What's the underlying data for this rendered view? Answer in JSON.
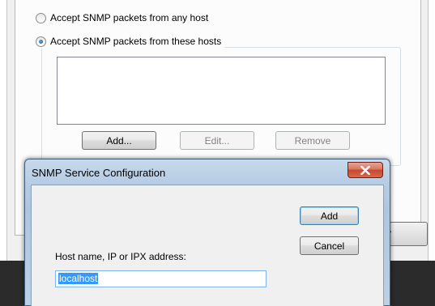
{
  "properties_window": {
    "radio_any": "Accept SNMP packets from any host",
    "radio_these": "Accept SNMP packets from these hosts",
    "add_label": "Add...",
    "edit_label": "Edit...",
    "remove_label": "Remove",
    "apply_label_partial": "y"
  },
  "dialog": {
    "title": "SNMP Service Configuration",
    "add_label": "Add",
    "cancel_label": "Cancel",
    "host_label": "Host name, IP or IPX address:",
    "host_value": "localhost"
  }
}
